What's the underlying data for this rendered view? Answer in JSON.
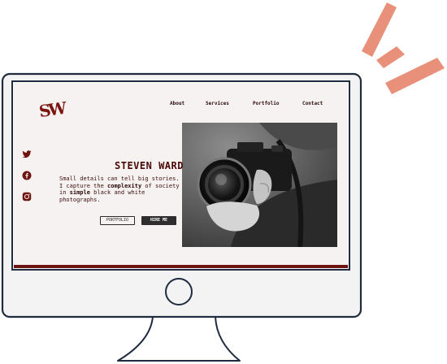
{
  "site": {
    "logo": "SW",
    "nav": [
      "About",
      "Services",
      "Portfolio",
      "Contact"
    ],
    "social_icons": [
      "twitter-icon",
      "facebook-icon",
      "instagram-icon"
    ],
    "hero": {
      "name": "STEVEN WARD",
      "text_1": "Small details can tell big stories. I capture the ",
      "emph_1": "complexity",
      "text_2": " of society in ",
      "emph_2": "simple",
      "text_3": " black and white photographs.",
      "portfolio_button": "PORTFOLIO",
      "hire_button": "HIRE ME"
    }
  },
  "colors": {
    "accent": "#7a1410",
    "ink": "#1f2b3f",
    "screen_bg": "#f6f2f1",
    "burst": "#e8907a"
  }
}
